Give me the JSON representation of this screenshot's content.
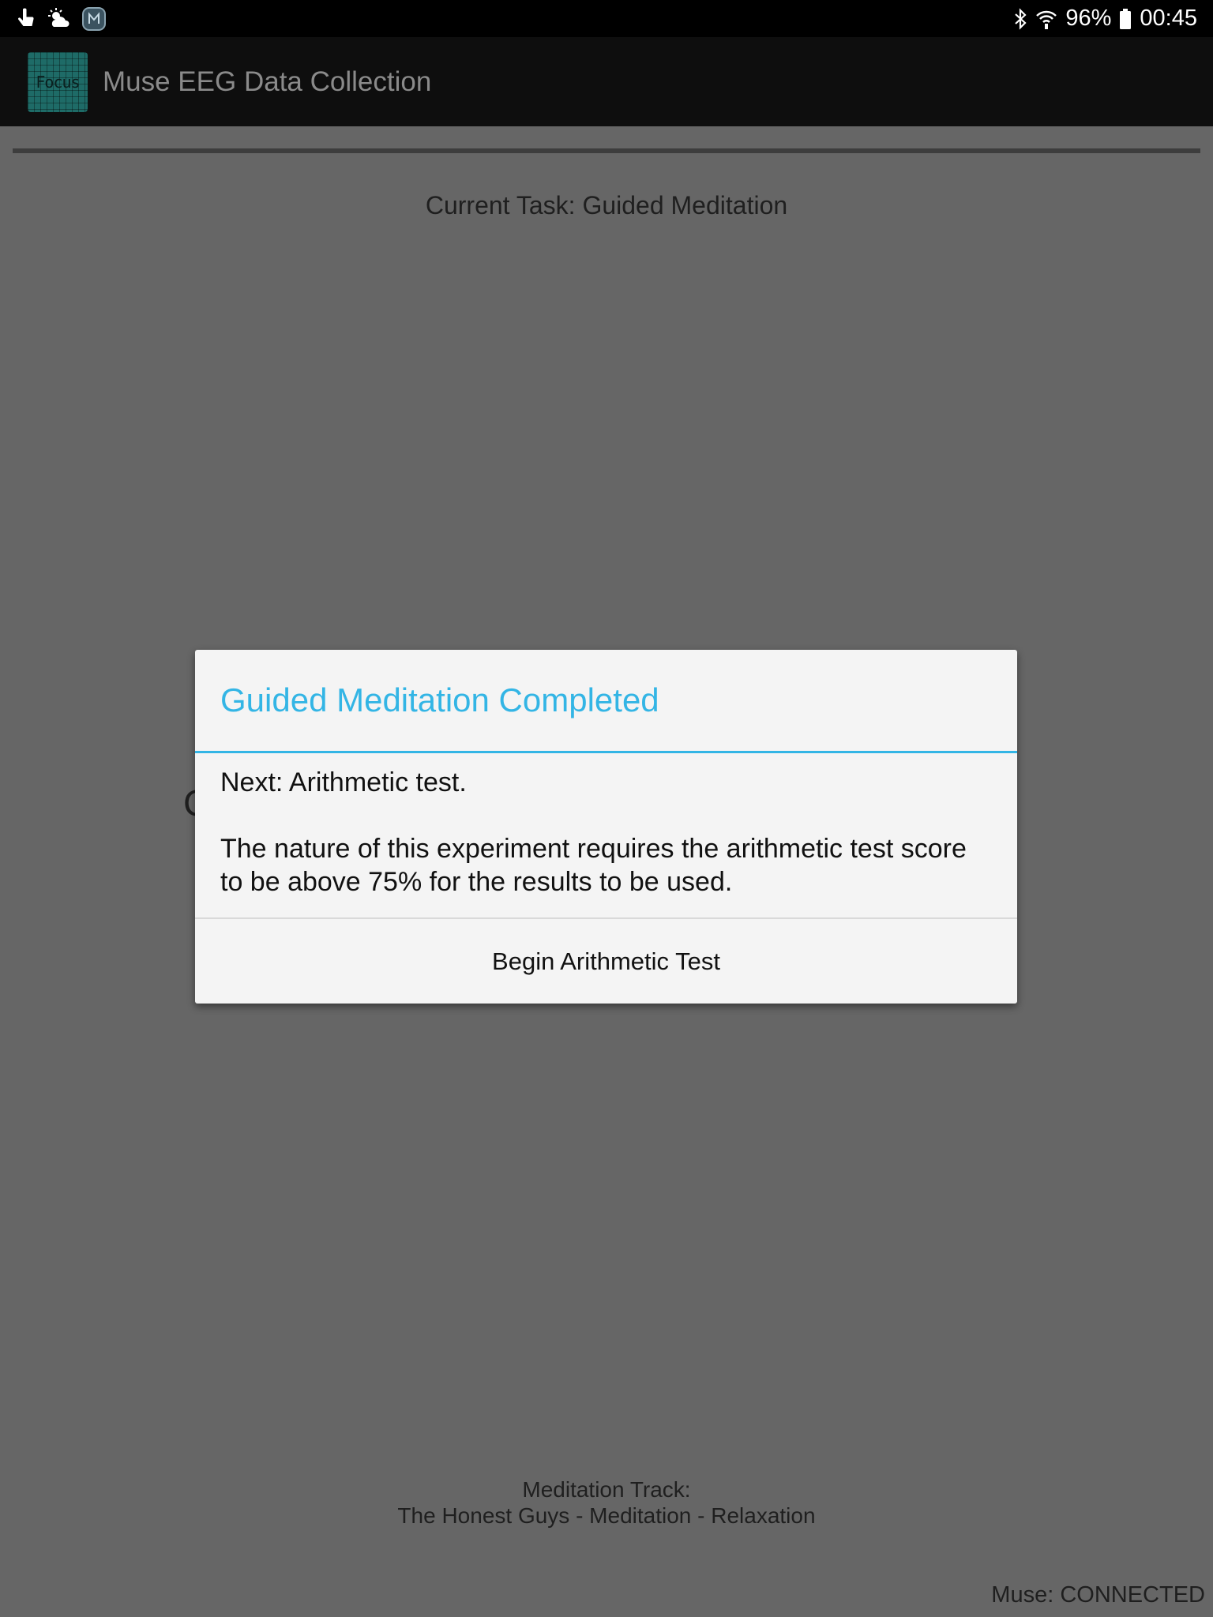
{
  "status_bar": {
    "battery": "96%",
    "time": "00:45",
    "left_icons": [
      "touch-icon",
      "weather-icon",
      "muse-app-icon"
    ],
    "right_icons": [
      "bluetooth-icon",
      "wifi-icon",
      "battery-icon"
    ]
  },
  "app_bar": {
    "icon_text": "Focus",
    "title": "Muse EEG Data Collection"
  },
  "main": {
    "current_task": "Current Task: Guided Meditation",
    "track_label": "Meditation Track:",
    "track_name": "The Honest Guys - Meditation - Relaxation",
    "muse_status": "Muse: CONNECTED",
    "occluded_glyph": "C"
  },
  "dialog": {
    "title": "Guided Meditation Completed",
    "next_line": "Next: Arithmetic test.",
    "message": "The nature of this experiment requires the arithmetic test score to be above 75% for the results to be used.",
    "button_label": "Begin Arithmetic Test"
  },
  "colors": {
    "accent": "#33b5e5",
    "dim_background": "#666666",
    "status_bar": "#000000",
    "app_bar": "#0e0e0e",
    "dialog_background": "#f4f4f4"
  }
}
